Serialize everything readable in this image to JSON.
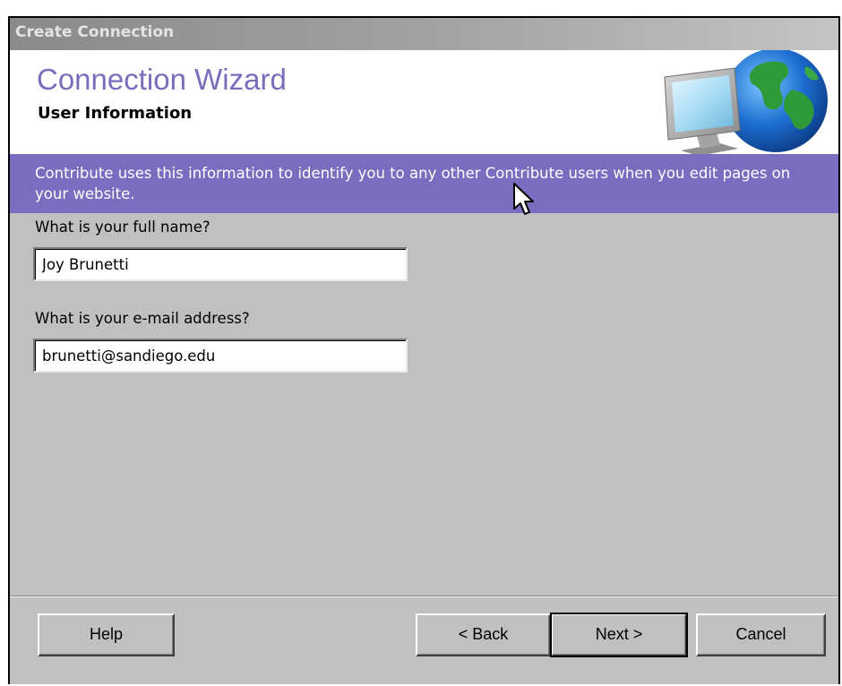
{
  "window": {
    "title": "Create Connection"
  },
  "header": {
    "title": "Connection Wizard",
    "subtitle": "User Information"
  },
  "banner": {
    "text": "Contribute uses this information to identify you to any other Contribute users when you edit pages on your website."
  },
  "form": {
    "name_label": "What is your full name?",
    "name_value": "Joy Brunetti",
    "email_label": "What is your e-mail address?",
    "email_value": "brunetti@sandiego.edu"
  },
  "buttons": {
    "help": "Help",
    "back": "< Back",
    "next": "Next >",
    "cancel": "Cancel"
  },
  "colors": {
    "accent": "#7a6cbf",
    "title_text": "#7b6cbc",
    "dialog_bg": "#c0c0c0"
  },
  "icons": {
    "header_graphic": "monitor-globe-icon",
    "pointer": "mouse-cursor-icon"
  }
}
